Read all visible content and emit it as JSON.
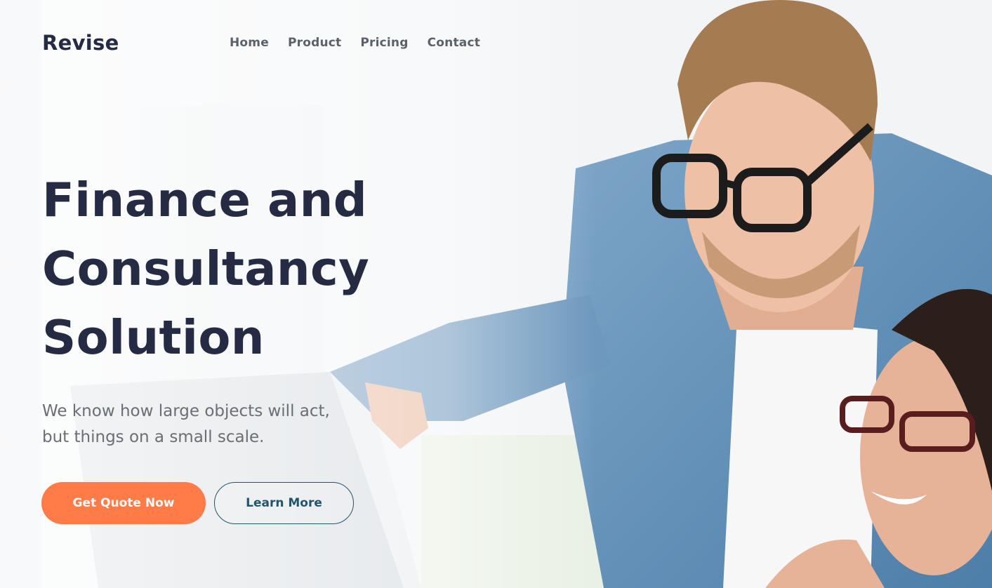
{
  "brand": {
    "logo_text": "Revise"
  },
  "nav": {
    "items": [
      {
        "label": "Home"
      },
      {
        "label": "Product"
      },
      {
        "label": "Pricing"
      },
      {
        "label": "Contact"
      }
    ]
  },
  "hero": {
    "title_lines": [
      "Finance and",
      "Consultancy",
      "Solution"
    ],
    "subtitle_lines": [
      "We know how large objects will act,",
      "but things on a small scale."
    ],
    "primary_button": "Get Quote Now",
    "secondary_button": "Learn More",
    "image": "photo-two-people-with-glasses-looking-at-screen"
  },
  "colors": {
    "primary": "#FF7B47",
    "heading": "#252B42",
    "outline": "#23556A",
    "nav_text": "#5a6169",
    "body_text": "#6a6f75"
  }
}
